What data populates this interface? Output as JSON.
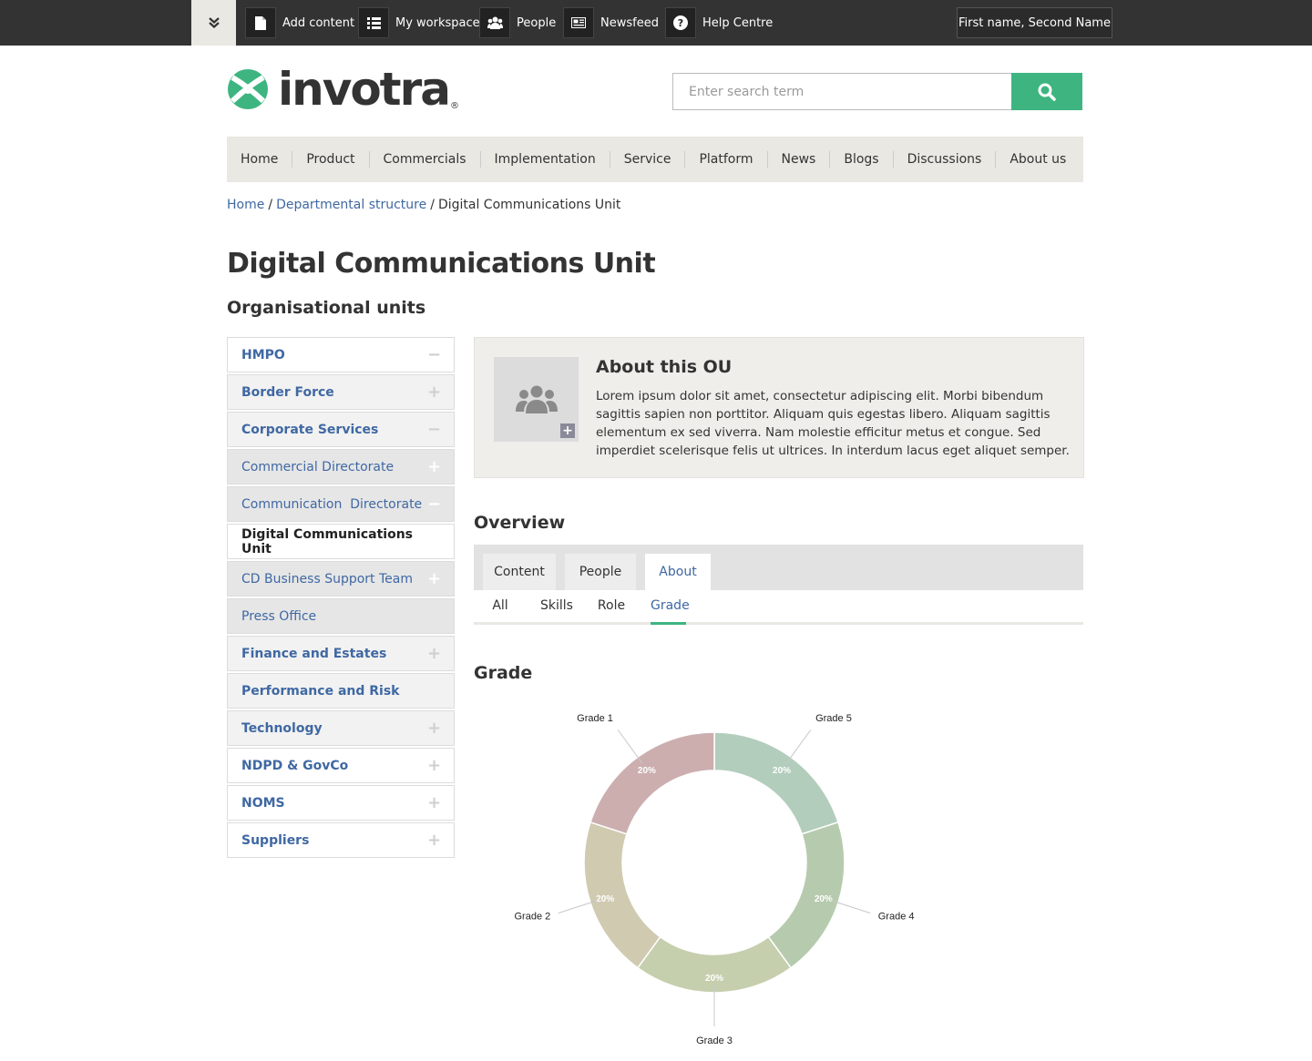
{
  "topbar": {
    "items": [
      {
        "label": "Add content",
        "icon": "document-icon"
      },
      {
        "label": "My workspace",
        "icon": "list-icon"
      },
      {
        "label": "People",
        "icon": "people-icon"
      },
      {
        "label": "Newsfeed",
        "icon": "newspaper-icon"
      },
      {
        "label": "Help Centre",
        "icon": "question-icon"
      }
    ],
    "user": "First name, Second Name"
  },
  "brand": {
    "name": "invotra",
    "reg": "®",
    "accent": "#3eb581"
  },
  "search": {
    "placeholder": "Enter search term"
  },
  "nav": [
    "Home",
    "Product",
    "Commercials",
    "Implementation",
    "Service",
    "Platform",
    "News",
    "Blogs",
    "Discussions",
    "About us"
  ],
  "breadcrumb": {
    "home": "Home",
    "sep": "/",
    "parent": "Departmental structure",
    "current": "Digital Communications Unit"
  },
  "page": {
    "title": "Digital Communications Unit",
    "subtitle": "Organisational units"
  },
  "units": [
    {
      "label": "HMPO",
      "toggle": "−"
    },
    {
      "label": "Border Force",
      "toggle": "+"
    },
    {
      "label": "Corporate Services",
      "toggle": "−"
    },
    {
      "label": "Commercial Directorate",
      "toggle": "+"
    },
    {
      "label": "Communication  Directorate",
      "toggle": "−"
    },
    {
      "label": "Digital Communications Unit",
      "toggle": ""
    },
    {
      "label": "CD Business Support Team",
      "toggle": "+"
    },
    {
      "label": "Press Office",
      "toggle": ""
    },
    {
      "label": "Finance and Estates",
      "toggle": "+"
    },
    {
      "label": "Performance and Risk",
      "toggle": ""
    },
    {
      "label": "Technology",
      "toggle": "+"
    },
    {
      "label": "NDPD & GovCo",
      "toggle": "+"
    },
    {
      "label": "NOMS",
      "toggle": "+"
    },
    {
      "label": "Suppliers",
      "toggle": "+"
    }
  ],
  "about": {
    "title": "About this OU",
    "text": "Lorem ipsum dolor sit amet, consectetur adipiscing elit. Morbi bibendum sagittis sapien non porttitor. Aliquam quis egestas libero. Aliquam sagittis elementum ex sed viverra. Nam molestie efficitur metus et congue. Sed imperdiet scelerisque felis ut ultrices. In interdum lacus eget aliquet semper. Duis massa eros, varius ut ipsum non,",
    "add": "+"
  },
  "overview": {
    "title": "Overview",
    "tabs": [
      "Content",
      "People",
      "About"
    ],
    "subtabs": [
      "All",
      "Skills",
      "Role",
      "Grade"
    ]
  },
  "grade": {
    "title": "Grade"
  },
  "chart_data": {
    "type": "pie",
    "variant": "donut",
    "categories": [
      "Grade 5",
      "Grade 4",
      "Grade 3",
      "Grade 2",
      "Grade 1"
    ],
    "values": [
      20,
      20,
      20,
      20,
      20
    ],
    "labels": [
      "20%",
      "20%",
      "20%",
      "20%",
      "20%"
    ],
    "colors": [
      "#b3cdbc",
      "#b6cbae",
      "#c5cfae",
      "#d0cab1",
      "#ccaeaf"
    ]
  }
}
